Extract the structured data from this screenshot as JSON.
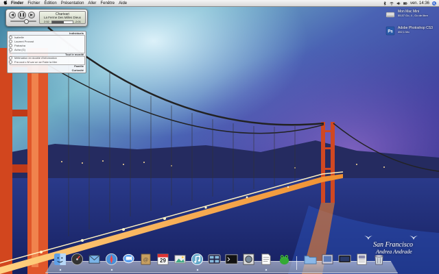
{
  "menubar": {
    "apple_icon": "apple-icon",
    "items": [
      "Finder",
      "Fichier",
      "Édition",
      "Présentation",
      "Aller",
      "Fenêtre",
      "Aide"
    ],
    "clock": "ven. 14:36",
    "status_icons": [
      "bluetooth-icon",
      "wifi-icon",
      "volume-icon",
      "battery-icon",
      "spotlight-icon"
    ]
  },
  "itunes_widget": {
    "title": "Charivari",
    "song": "La Ferme Des Milles Dieux",
    "elapsed": "2:52",
    "remaining": "-2:01",
    "progress": 0.58,
    "volume": 0.6,
    "buttons": [
      "previous",
      "pause",
      "next"
    ]
  },
  "mail_panel": {
    "section_individuals": "Individuels",
    "contacts": [
      "Isabelle",
      "Laurent Provost",
      "Patracha",
      "Acha (G)"
    ],
    "section_all": "Tout le monde",
    "messages": [
      "Mélimation en double d'information",
      "Fra cool c M uar un se Faire la Mer"
    ],
    "section_family": "Famille",
    "section_curiosity": "Curiosité"
  },
  "desktop_icons": [
    {
      "title": "Mon Mac Mini",
      "subtitle": "55,57 Go, 4 , Go de libre",
      "icon": "hard-drive-icon"
    },
    {
      "title": "Adobe Photoshop CS3",
      "subtitle": "452,1 Mo",
      "icon": "photoshop-icon"
    }
  ],
  "watermark": {
    "line1": "San Francisco",
    "line2": "Andrea Andrade"
  },
  "dock": {
    "items": [
      "finder-icon",
      "dashboard-icon",
      "mail-icon",
      "safari-icon",
      "ichat-icon",
      "address-book-icon",
      "ical-icon",
      "iphoto-icon",
      "itunes-icon",
      "expose-icon",
      "terminal-icon",
      "preview-icon",
      "textedit-icon",
      "frog-icon",
      "folder-icon",
      "downloads-icon",
      "screen-icon",
      "document-icon",
      "trash-icon"
    ],
    "ical_date": "29"
  },
  "colors": {
    "menubar": "#e6e6e6",
    "accent_bridge": "#e8562a",
    "sky": "#3a4fa8"
  }
}
